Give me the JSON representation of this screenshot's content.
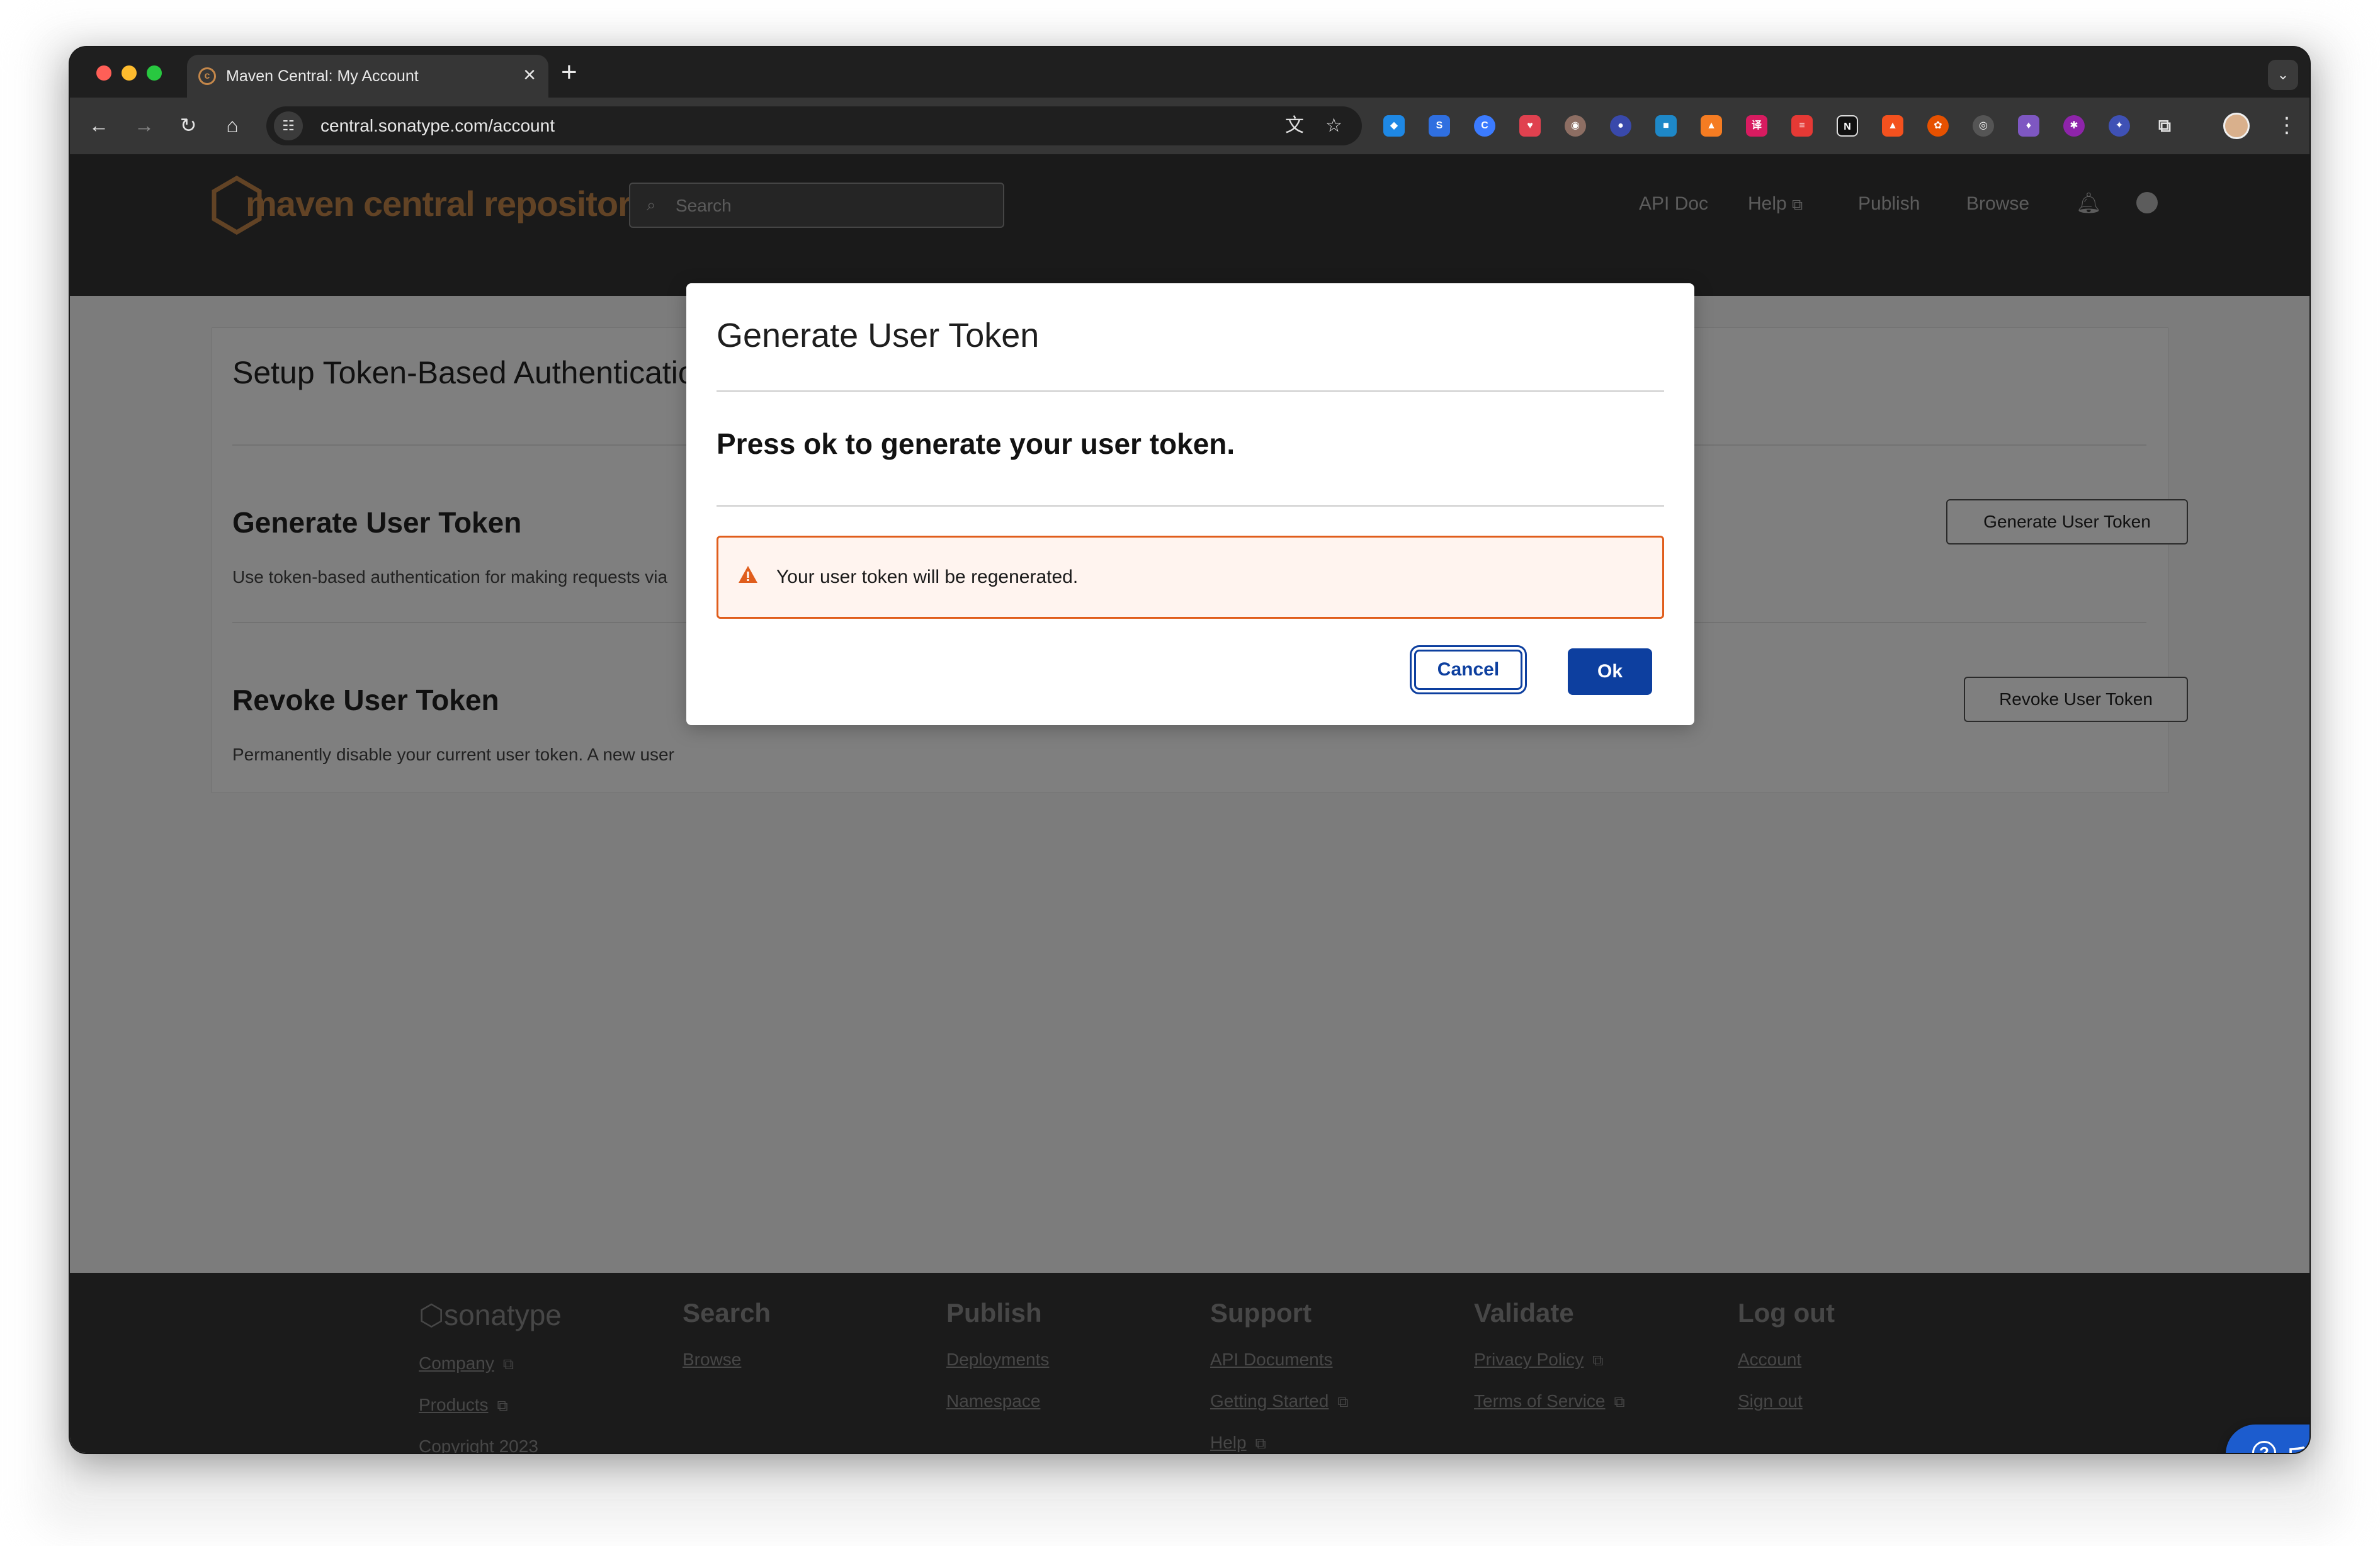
{
  "browser": {
    "tab_title": "Maven Central: My Account",
    "tab_close": "×",
    "new_tab": "+",
    "url": "central.sonatype.com/account",
    "extensions": [
      "gem-icon",
      "swirl-icon",
      "c-icon",
      "pocket-icon",
      "owl-icon",
      "ghost-icon",
      "cube-icon",
      "fox-icon",
      "translate-icon",
      "list-icon",
      "notion-icon",
      "rocket-icon",
      "gear-flower-icon",
      "circle-icon",
      "drop-icon",
      "brain-icon",
      "hex-star-icon",
      "puzzle-icon"
    ]
  },
  "header": {
    "logo_text": "maven central repository",
    "search_placeholder": "Search",
    "nav": {
      "api_doc": "API Doc",
      "help": "Help",
      "publish": "Publish",
      "browse": "Browse"
    }
  },
  "card": {
    "title": "Setup Token-Based Authentication",
    "generate": {
      "title": "Generate User Token",
      "desc": "Use token-based authentication for making requests via",
      "button": "Generate User Token"
    },
    "revoke": {
      "title": "Revoke User Token",
      "desc": "Permanently disable your current user token. A new user",
      "button": "Revoke User Token"
    }
  },
  "modal": {
    "title": "Generate User Token",
    "message": "Press ok to generate your user token.",
    "alert": "Your user token will be regenerated.",
    "cancel": "Cancel",
    "ok": "Ok"
  },
  "footer": {
    "brand": "sonatype",
    "company": "Company",
    "products": "Products",
    "copyright": "Copyright 2023",
    "search_head": "Search",
    "browse": "Browse",
    "publish_head": "Publish",
    "deployments": "Deployments",
    "namespace": "Namespace",
    "support_head": "Support",
    "api_documents": "API Documents",
    "getting_started": "Getting Started",
    "help": "Help",
    "validate_head": "Validate",
    "privacy": "Privacy Policy",
    "terms": "Terms of Service",
    "logout_head": "Log out",
    "account": "Account",
    "sign_out": "Sign out"
  },
  "feedback": {
    "label": "反馈"
  },
  "colors": {
    "primary": "#0d3f9f",
    "brand_orange": "#c4874a",
    "alert_border": "#e05d1c",
    "alert_bg": "#fff4ef"
  }
}
